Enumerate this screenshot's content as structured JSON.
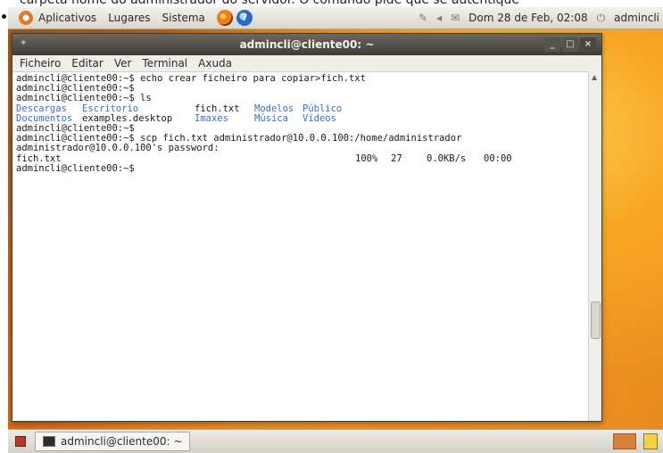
{
  "caption": {
    "text": "carpeta home do administrador do servidor. O comando pide que se autentique"
  },
  "top_panel": {
    "menu": [
      "Aplicativos",
      "Lugares",
      "Sistema"
    ],
    "clock": "Dom 28 de Feb, 02:08",
    "user": "admincli"
  },
  "window": {
    "title": "admincli@cliente00: ~",
    "menu": [
      "Ficheiro",
      "Editar",
      "Ver",
      "Terminal",
      "Axuda"
    ]
  },
  "terminal": {
    "lines": [
      "admincli@cliente00:~$ echo crear ficheiro para copiar>fich.txt",
      "admincli@cliente00:~$",
      "admincli@cliente00:~$ ls"
    ],
    "ls_row1": [
      "Descargas",
      "Escritorio",
      "fich.txt",
      "Modelos",
      "Público"
    ],
    "ls_row2": [
      "Documentos",
      "examples.desktop",
      "Imaxes",
      "Música",
      "Vídeos"
    ],
    "lines2": [
      "admincli@cliente00:~$",
      "admincli@cliente00:~$ scp fich.txt administrador@10.0.0.100:/home/administrador",
      "administrador@10.0.0.100's password:"
    ],
    "progress": {
      "file": "fich.txt",
      "percent": "100%",
      "size": "27",
      "speed": "0.0KB/s",
      "time": "00:00"
    },
    "last_prompt": "admincli@cliente00:~$"
  },
  "bottom_panel": {
    "task_label": "admincli@cliente00: ~"
  }
}
